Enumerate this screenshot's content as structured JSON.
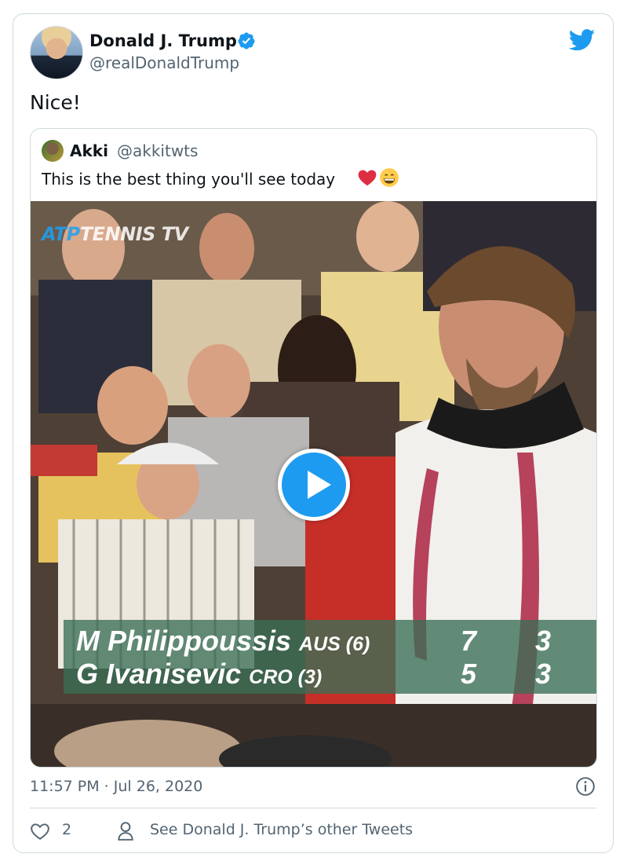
{
  "tweet": {
    "author_name": "Donald J. Trump",
    "author_handle": "@realDonaldTrump",
    "text": "Nice!",
    "timestamp": "11:57 PM · Jul 26, 2020",
    "likes": "2",
    "other_tweets_label": "See Donald J. Trump’s other Tweets",
    "accent_color": "#1d9bf0"
  },
  "quote": {
    "author_name": "Akki",
    "author_handle": "@akkitwts",
    "text": "This is the best thing you'll see today",
    "emoji": [
      "❤️",
      "😁"
    ]
  },
  "media": {
    "watermark_atp": "ATP",
    "watermark_rest": "TENNIS TV",
    "scoreboard": [
      {
        "player": "M Philippoussis",
        "country": "AUS (6)",
        "set1": "7",
        "set2": "3"
      },
      {
        "player": "G Ivanisevic",
        "country": "CRO (3)",
        "set1": "5",
        "set2": "3"
      }
    ]
  },
  "icons": {
    "verified": "verified-badge-icon",
    "logo": "twitter-bird-icon",
    "info": "info-icon",
    "like": "heart-icon",
    "profile": "person-icon",
    "play": "play-icon"
  }
}
